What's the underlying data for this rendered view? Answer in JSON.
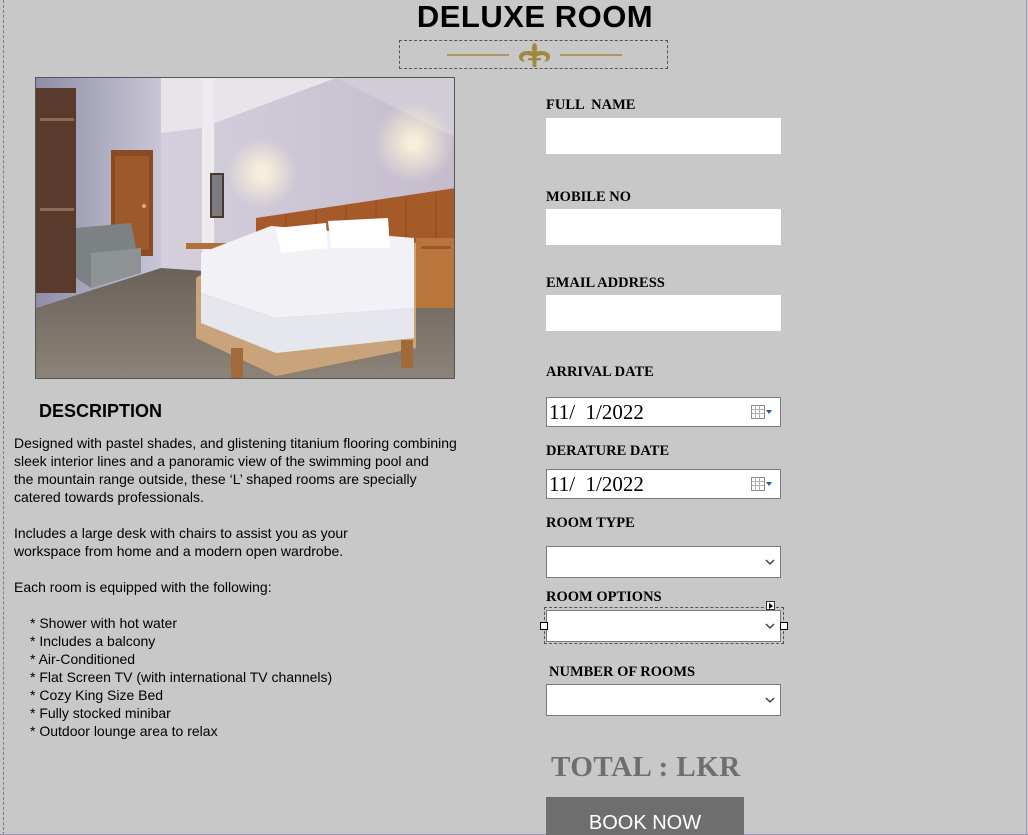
{
  "page": {
    "title": "DELUXE ROOM"
  },
  "description": {
    "heading": "DESCRIPTION",
    "paragraph1": "Designed with pastel shades, and glistening titanium flooring combining\n sleek interior lines and a panoramic view of the swimming pool and\n the mountain range outside, these ‘L’ shaped rooms are specially\ncatered towards professionals.",
    "paragraph2": "Includes a large desk with chairs to assist you as your\nworkspace from home and a modern open wardrobe.",
    "paragraph3": "Each room is equipped with the following:",
    "features": [
      "* Shower with hot water",
      "* Includes a balcony",
      "* Air-Conditioned",
      "* Flat Screen TV (with international TV channels)",
      "* Cozy King Size Bed",
      "* Fully stocked minibar",
      "* Outdoor lounge area to relax"
    ]
  },
  "form": {
    "full_name_label": "FULL  NAME",
    "full_name_value": "",
    "mobile_label": "MOBILE NO",
    "mobile_value": "",
    "email_label": "EMAIL ADDRESS",
    "email_value": "",
    "arrival_label": "ARRIVAL DATE",
    "arrival_value": "11/  1/2022",
    "departure_label": "DERATURE DATE",
    "departure_value": "11/  1/2022",
    "room_type_label": "ROOM TYPE",
    "room_type_value": "",
    "room_options_label": "ROOM OPTIONS",
    "room_options_value": "",
    "num_rooms_label": "NUMBER OF ROOMS",
    "num_rooms_value": ""
  },
  "total_label": "TOTAL : LKR",
  "book_button": "BOOK NOW",
  "icons": {
    "ornament": "fleur-de-lis-divider-icon",
    "calendar": "calendar-icon",
    "dropdown": "chevron-down-icon"
  },
  "colors": {
    "background": "#c8c8c8",
    "ornament": "#a08840",
    "total_text": "#6e6e6e",
    "button": "#6e6e6e"
  }
}
